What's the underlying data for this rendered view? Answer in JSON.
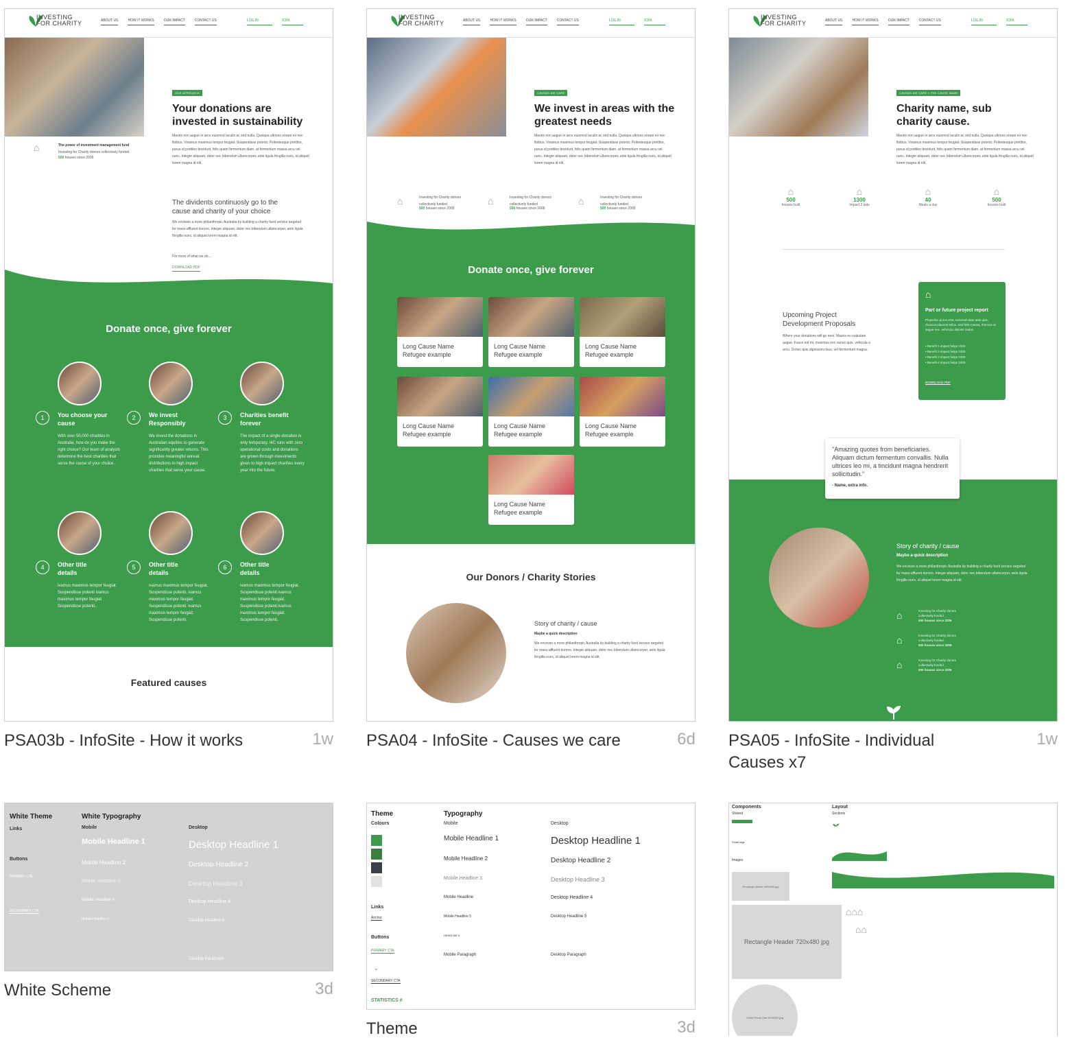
{
  "site": {
    "logo_line1": "INVESTING",
    "logo_line2": "FOR CHARITY",
    "nav": [
      "ABOUT US",
      "HOW IT WORKS",
      "OUR IMPACT",
      "CONTACT US"
    ],
    "login": "LOG IN",
    "join": "JOIN"
  },
  "cards": [
    {
      "caption": "PSA03b - InfoSite - How it works",
      "age": "1w"
    },
    {
      "caption": "PSA04 - InfoSite - Causes we care",
      "age": "6d"
    },
    {
      "caption": "PSA05 - InfoSite - Individual Causes x7",
      "age": "1w"
    },
    {
      "caption": "White Scheme",
      "age": "3d"
    },
    {
      "caption": "Theme",
      "age": "3d"
    }
  ],
  "psa03": {
    "tag": "OUR APPROACH",
    "headline": "Your donations are invested in sustainability",
    "body": "Mauris non augue in arcu euismod iaculis ac sed nulla. Quisque ultrices ornare ex nec finibus. Vivamus maximus tempor feugiat. Suspendisse potenti. Pellentesque porttitor, purus id porttitor tincidunt, felis quam fermentum diam, at fermentum massa arcu vel nunc. Integer aliquam, dolor nec bibendum ullamcorper, ante ligula fringilla nunc, id aliquet lorem magna id elit.",
    "fund_title": "The power of investment management fund",
    "fund_text": "Investing for Charity donors collectively funded",
    "fund_stat": "500",
    "fund_stat_text": "houses since 2009",
    "sub_headline": "The dividents continuosly go to the cause and charity of your choice",
    "sub_body": "We envision a more philanthropic Australia by building a charity fund service targeted for mass-affluent donors. Integer aliquam, dolor nec bibendum ullamcorper, ante ligula fringilla nunc, id aliquet lorem magna id elit.",
    "more": "For more of what we do....",
    "download": "DOWNLOAD PDF",
    "donate": "Donate once, give forever",
    "steps": [
      {
        "num": "1",
        "title": "You choose your cause",
        "text": "With over 50,000 charities in Australia, how do you make the right choice? Our team of analysts determine the best charities that serve the cause of your choice."
      },
      {
        "num": "2",
        "title": "We invest Responsibly",
        "text": "We invest the donations in Australian equities to generate significantly greater returns. This provides meaningful annual distributions to high impact charities that serve your cause."
      },
      {
        "num": "3",
        "title": "Charities benefit forever",
        "text": "The impact of a single donation is only temporary. I4C runs with zero operational costs and donations are grown through investments given to high impact charities every year into the future."
      },
      {
        "num": "4",
        "title": "Other title details",
        "text": "ivamus maximus tempor feugiat. Suspendisse potenti ivamus maximus tempor feugiat. Suspendisse potenti.."
      },
      {
        "num": "5",
        "title": "Other title details",
        "text": "ivamus maximus tempor feugiat. Suspendisse potenti. ivamus maximus tempor feugiat. Suspendisse potenti. ivamus maximus tempor feugiat. Suspendisse potenti."
      },
      {
        "num": "6",
        "title": "Other title details",
        "text": "ivamus maximus tempor feugiat. Suspendisse potenti.ivamus maximus tempor feugiat. Suspendisse potenti.ivamus maximus tempor feugiat. Suspendisse potenti."
      }
    ],
    "featured": "Featured causes"
  },
  "psa04": {
    "tag": "CAUSES WE CARE",
    "headline": "We invest in areas with the greatest needs",
    "body": "Mauris non augue in arcu euismod iaculis ac sed nulla. Quisque ultrices ornare ex nec finibus. Vivamus maximus tempor feugiat. Suspendisse potenti. Pellentesque porttitor, purus id porttitor tincidunt, felis quam fermentum diam, at fermentum massa arcu vel nunc. Integer aliquam, dolor nec bibendum ullamcorper, ante ligula fringilla nunc, id aliquet lorem magna id elit.",
    "stat_text": "Investing for Charity donors collectively funded",
    "stat_num": "500",
    "stat_unit": "houses since 2009",
    "donate": "Donate once, give forever",
    "tiles": [
      "Long Cause Name Refugee example",
      "Long Cause Name Refugee example",
      "Long Cause Name Refugee example",
      "Long Cause Name Refugee example",
      "Long Cause Name Refugee example",
      "Long Cause Name Refugee example",
      "Long Cause Name Refugee example"
    ],
    "donors": "Our Donors / Charity Stories",
    "story_title": "Story of charity / cause",
    "story_sub": "Maybe a quick description",
    "story_body": "We envision a more philanthropic Australia by building a charity fund service targeted for mass-affluent donors. Integer aliquam, dolor nec bibendum ullamcorper, ante ligula fringilla nunc, id aliquet lorem magna id elit."
  },
  "psa05": {
    "tag1": "CAUSES WE CARE",
    "tag2": "THE CAUSE NAME",
    "headline": "Charity name, sub charity cause.",
    "body": "Mauris non augue in arcu euismod iaculis ac sed nulla. Quisque ultrices ornare ex nec finibus. Vivamus maximus tempor feugiat. Suspendisse potenti. Pellentesque porttitor, purus id porttitor tincidunt, felis quam fermentum diam, at fermentum massa arcu vel nunc. Integer aliquam, dolor nec bibendum ullamcorper, ante ligula fringilla nunc, id aliquet lorem magna id elit.",
    "stats": [
      {
        "n": "500",
        "l": "houses built"
      },
      {
        "n": "1300",
        "l": "Impact 2 kids"
      },
      {
        "n": "40",
        "l": "Meals a day"
      },
      {
        "n": "500",
        "l": "houses built"
      }
    ],
    "upcoming": "Upcoming Project Development Proposals",
    "upcoming_body": "Where your donations will go next. Mauris eu vulputate augue. Fusce est mi, maximus nec varius quis, vehicula a arcu. Donec quis dignissim risus, vel fermentum magna.",
    "report_title": "Part or future project report",
    "report_body": "Phasellus purus erat, euismod vitae ante quis, rhoncus placerat tellus. Sed felis massa, rhoncus ut augue nec, vehicula ultricies metus.",
    "benefits": [
      "• Benefit 1 impact helps 1000",
      "• Benefit 2 impact helps 1000",
      "• Benefit 3 impact helps 1000",
      "• Benefit 4 impact helps 1000"
    ],
    "report_dl": "DOWNLOAD PDF",
    "quote": "\"Amazing quotes from beneficiaries. Aliquam dictum fermentum convallis. Nulla ultrices leo mi, a tincidunt magna hendrerit sollicitudin.\"",
    "quote_name": "- Name, extra info.",
    "story_title": "Story of charity / cause",
    "story_sub": "Maybe a quick description",
    "story_body": "We envision a more philanthropic Australia by building a charity fund service targeted for mass-affluent donors. Integer aliquam, dolor nec bibendum ullamcorper, ante ligula fringilla nunc, id aliquet lorem magna id elit.",
    "mini_text": "Investing for Charity donors collectively funded",
    "mini_stat": "500 houses since 2009"
  },
  "white_scheme": {
    "theme": "White Theme",
    "typography": "White Typography",
    "mobile": "Mobile",
    "desktop": "Desktop",
    "links": "Links",
    "buttons": "Buttons",
    "mobile_heads": [
      "Mobile Headline 1",
      "Mobile Headline 2",
      "Mobile Headline 3",
      "Mobile Headline 4",
      "Mobile Headline 5"
    ],
    "desktop_heads": [
      "Desktop Headline 1",
      "Desktop Headline 2",
      "Desktop Headline 3",
      "Desktop Headline 4",
      "Desktop Headline 5"
    ],
    "desktop_para": "Desktop Paragraph",
    "primary": "PRIMARY CTA",
    "secondary": "SECONDARY CTA"
  },
  "theme": {
    "theme": "Theme",
    "colours": "Colours",
    "typography": "Typography",
    "mobile": "Mobile",
    "desktop": "Desktop",
    "links": "Links",
    "anchor": "Anchor",
    "buttons": "Buttons",
    "primary": "PRIMARY CTA",
    "secondary": "SECONDARY CTA",
    "statistics": "STATISTICS #",
    "mobile_heads": [
      "Mobile Headline 1",
      "Mobile Headline 2",
      "Mobile Headline 3",
      "Mobile Headline",
      "Mobile Headline 5",
      "HEADLINE 6"
    ],
    "mobile_para": "Mobile Paragraph",
    "desktop_heads": [
      "Desktop Headline 1",
      "Desktop Headline 2",
      "Desktop Headline 3",
      "Desktop Headline 4",
      "Desktop Headline 5"
    ],
    "desktop_para": "Desktop Paragraph",
    "swatches": [
      "#3d9c4c",
      "#3b7d3f",
      "#3a3f4a",
      "#e2e2e2"
    ]
  },
  "components": {
    "components": "Components",
    "shared": "Shared",
    "layout": "Layout",
    "sections": "Sections",
    "small_tags": "Small tags",
    "images": "Images",
    "rect_article": "Rectangle Article 400x300.jpg",
    "rect_header": "Rectangle Header 720x480 jpg",
    "circle": "Circle Photo Size 520x520.jpg"
  },
  "colors": {
    "green": "#3d9c4c"
  }
}
